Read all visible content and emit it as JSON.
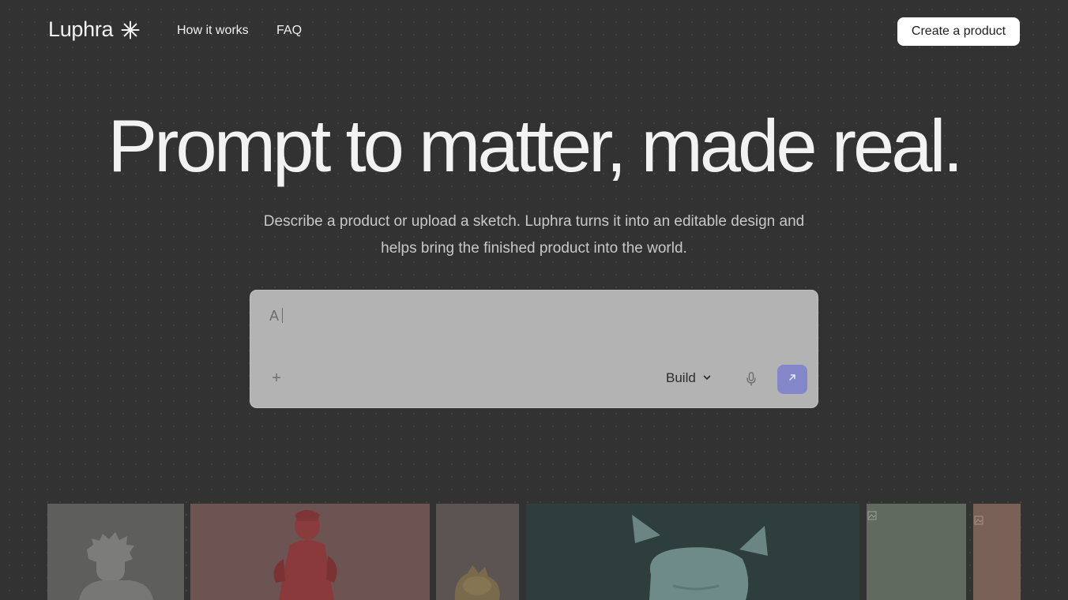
{
  "nav": {
    "logo": "Luphra",
    "links": [
      "How it works",
      "FAQ"
    ],
    "cta": "Create a product"
  },
  "hero": {
    "headline": "Prompt to matter, made real.",
    "subtitle_line1": "Describe a product or upload a sketch. Luphra turns it into an editable design and",
    "subtitle_line2": "helps bring the finished product into the world."
  },
  "prompt": {
    "typed_value": "A",
    "add_glyph": "+",
    "mode_label": "Build"
  },
  "icons": {
    "logo": "sparkle-icon",
    "add": "plus-icon",
    "mode": "chevron-down-icon",
    "mic": "microphone-icon",
    "send": "arrow-up-right-icon"
  },
  "colors": {
    "background": "#333233",
    "send_button": "#8486ca",
    "prompt_box": "#b3b3b3"
  },
  "gallery": {
    "tiles": [
      {
        "subject": "figure-bust",
        "bg": "#5e5e5c"
      },
      {
        "subject": "red-figurine",
        "bg": "#6b5452"
      },
      {
        "subject": "gold-toy",
        "bg": "#5b5453"
      },
      {
        "subject": "rabbit-figure",
        "bg": "#2d3e3d"
      },
      {
        "subject": "broken-image",
        "bg": "#616a5f"
      },
      {
        "subject": "broken-image",
        "bg": "#7a6158"
      }
    ]
  }
}
